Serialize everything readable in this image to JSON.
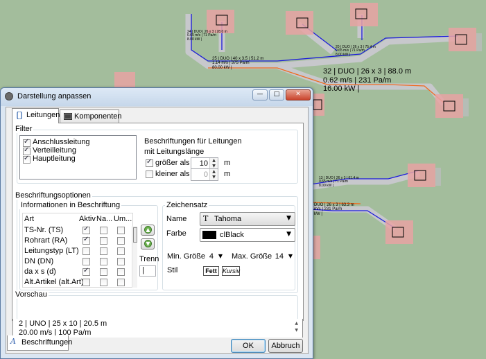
{
  "background": {
    "labels": [
      {
        "text": [
          "24 | DUO | 26 x 3 | 28.0 m",
          "0.65 m/s | 71 Pa/m",
          "8.00 kW |"
        ],
        "size": "small"
      },
      {
        "text": [
          "25 | DUO | 40 x 3.5 | 51.2 m",
          "1.14 m/s | 375 Pa/m",
          "80.00 kW |"
        ],
        "size": "mid"
      },
      {
        "text": [
          "20 | DUO | 26 x 3 | 75.4 m",
          "0.65 m/s | 71 Pa/m",
          "8.00 kW |"
        ],
        "size": "small"
      },
      {
        "text": [
          "32 | DUO | 26 x 3 | 88.0 m",
          "0.62 m/s | 231 Pa/m",
          "16.00 kW |"
        ],
        "size": "big"
      },
      {
        "text": [
          "13 | DUO | 26 x 3 | 61.4 m",
          "0.65 m/s | 71 Pa/m",
          "8.00 kW |"
        ],
        "size": "small"
      },
      {
        "text": [
          "DUO | 26 x 3 | 63.3 m",
          "m/s | 231 Pa/m",
          "kW |"
        ],
        "size": "small"
      }
    ],
    "colors": {
      "canvas": "#a3bd9c",
      "pipe_gray": "#c9c9cf",
      "pipe_blue": "#1a1adb",
      "pipe_orange": "#f06a1e",
      "node_red": "#e8a3a3"
    }
  },
  "dialog": {
    "title": "Darstellung anpassen",
    "window_buttons": {
      "minimize": "—",
      "maximize": "□",
      "close": "✕"
    },
    "tabs": [
      {
        "label": "Leitungen",
        "icon": "pipe-icon",
        "active": true
      },
      {
        "label": "Komponenten",
        "icon": "component-icon",
        "active": false
      }
    ],
    "filter": {
      "title": "Filter",
      "items": [
        {
          "label": "Anschlussleitung",
          "checked": true
        },
        {
          "label": "Verteilleitung",
          "checked": true
        },
        {
          "label": "Hauptleitung",
          "checked": true
        }
      ],
      "captions": {
        "title": "Beschriftungen für Leitungen",
        "subtitle": "mit Leitungslänge",
        "greater": {
          "label": "größer als",
          "checked": true,
          "value": "10",
          "unit": "m"
        },
        "smaller": {
          "label": "kleiner als",
          "checked": false,
          "value": "0",
          "unit": "m"
        }
      }
    },
    "caption_options": {
      "title": "Beschriftungsoptionen",
      "info": {
        "title": "Informationen in Beschriftung",
        "headers": {
          "art": "Art",
          "aktiv": "Aktiv",
          "na": "Na...",
          "um": "Um..."
        },
        "rows": [
          {
            "art": "TS-Nr. (TS)",
            "aktiv": true,
            "na": false,
            "um": false
          },
          {
            "art": "Rohrart (RA)",
            "aktiv": true,
            "na": false,
            "um": false
          },
          {
            "art": "Leitungstyp (LT)",
            "aktiv": false,
            "na": false,
            "um": false
          },
          {
            "art": "DN (DN)",
            "aktiv": false,
            "na": false,
            "um": false
          },
          {
            "art": "da x s (d)",
            "aktiv": true,
            "na": false,
            "um": false
          },
          {
            "art": "Alt.Artikel (alt.Art)",
            "aktiv": false,
            "na": false,
            "um": false
          }
        ],
        "separator_label": "Trenn",
        "separator_value": "|"
      },
      "font": {
        "title": "Zeichensatz",
        "name_label": "Name",
        "name_value": "Tahoma",
        "color_label": "Farbe",
        "color_value": "clBlack",
        "color_swatch": "#000000",
        "min_size_label": "Min. Größe",
        "min_size_value": "4",
        "max_size_label": "Max. Größe",
        "max_size_value": "14",
        "style_label": "Stil",
        "bold_label": "Fett",
        "italic_label": "Kursiv"
      }
    },
    "preview": {
      "title": "Vorschau",
      "lines": [
        "2 | UNO | 25 x 10 | 20.5 m",
        "20.00 m/s | 100 Pa/m"
      ]
    },
    "bottom_tab": {
      "label": "Beschriftungen",
      "icon": "caption-icon"
    },
    "buttons": {
      "ok": "OK",
      "cancel": "Abbruch"
    }
  }
}
